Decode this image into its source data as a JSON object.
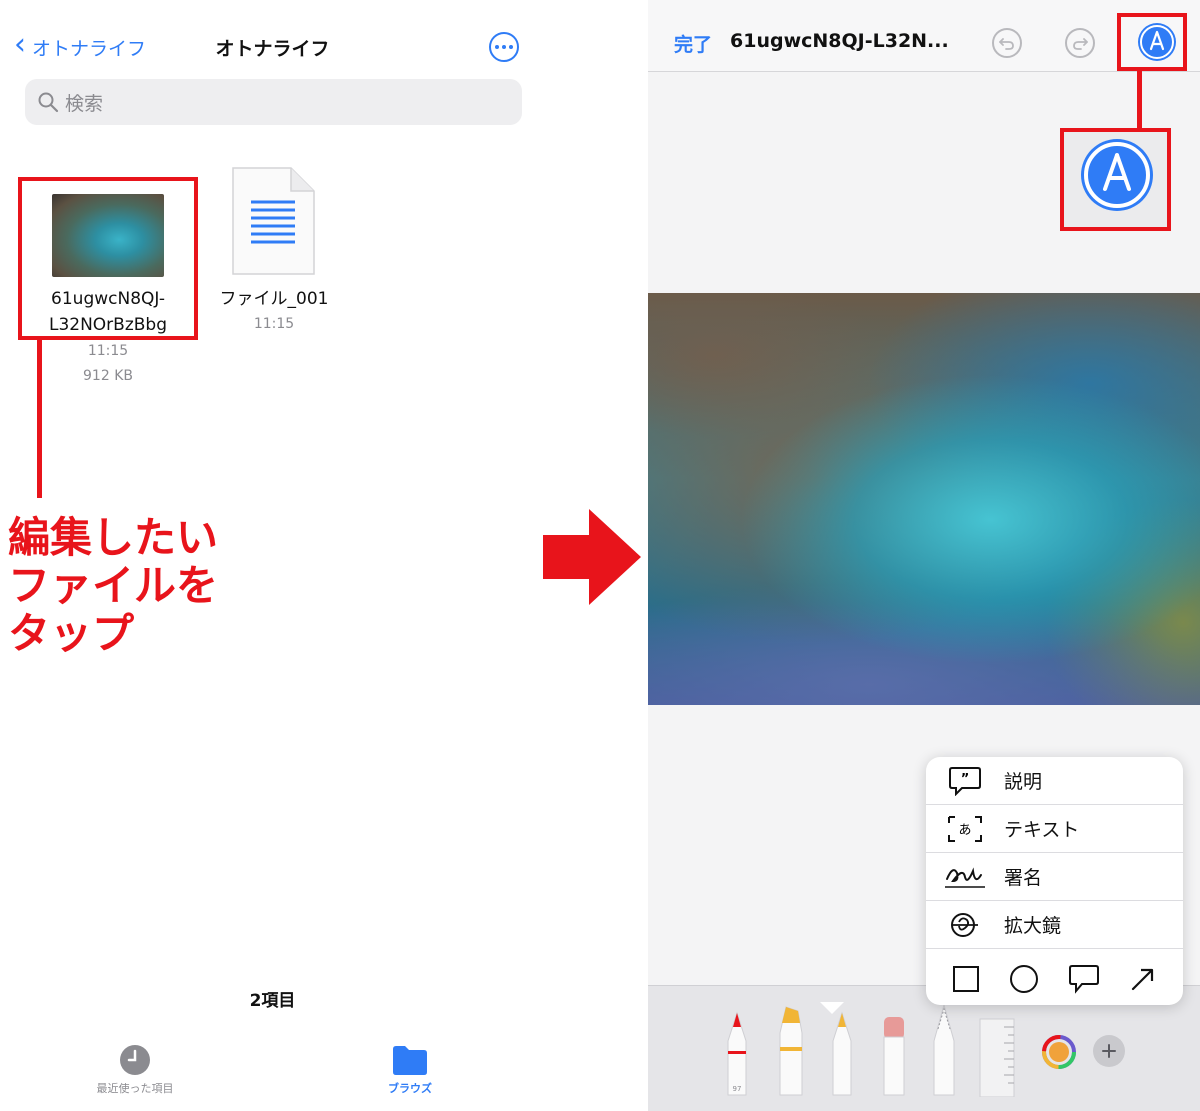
{
  "colors": {
    "accent": "#2f7cf6",
    "annotation_red": "#e8141b",
    "secondary_text": "#8b8b90"
  },
  "files_app": {
    "back_label": "オトナライフ",
    "title": "オトナライフ",
    "search_placeholder": "検索",
    "files": [
      {
        "name_line1": "61ugwcN8QJ-",
        "name_line2": "L32NOrBzBbg",
        "time": "11:15",
        "size": "912 KB",
        "icon": "photo-thumbnail"
      },
      {
        "name": "ファイル_001",
        "time": "11:15",
        "icon": "document-icon"
      }
    ],
    "item_count": "2項目",
    "tabs": [
      {
        "label": "最近使った項目",
        "icon": "clock-icon",
        "selected": false
      },
      {
        "label": "ブラウズ",
        "icon": "folder-icon",
        "selected": true
      }
    ]
  },
  "annotation": {
    "caption_lines": [
      "編集したい",
      "ファイルを",
      "タップ"
    ]
  },
  "markup_editor": {
    "done_label": "完了",
    "doc_title": "61ugwcN8QJ-L32N...",
    "toolbar_icons": [
      "undo-icon",
      "redo-icon",
      "markup-icon"
    ],
    "menu": [
      {
        "label": "説明",
        "icon": "quote-bubble-icon"
      },
      {
        "label": "テキスト",
        "icon": "text-box-icon"
      },
      {
        "label": "署名",
        "icon": "signature-icon"
      },
      {
        "label": "拡大鏡",
        "icon": "magnifier-icon"
      }
    ],
    "shapes": [
      "square-icon",
      "circle-icon",
      "speech-bubble-icon",
      "arrow-icon"
    ],
    "tools": [
      "pen-tool",
      "highlighter-tool",
      "pencil-tool",
      "eraser-tool",
      "lasso-tool",
      "ruler-tool",
      "color-picker",
      "add-button"
    ],
    "pen_width_label": "97"
  }
}
